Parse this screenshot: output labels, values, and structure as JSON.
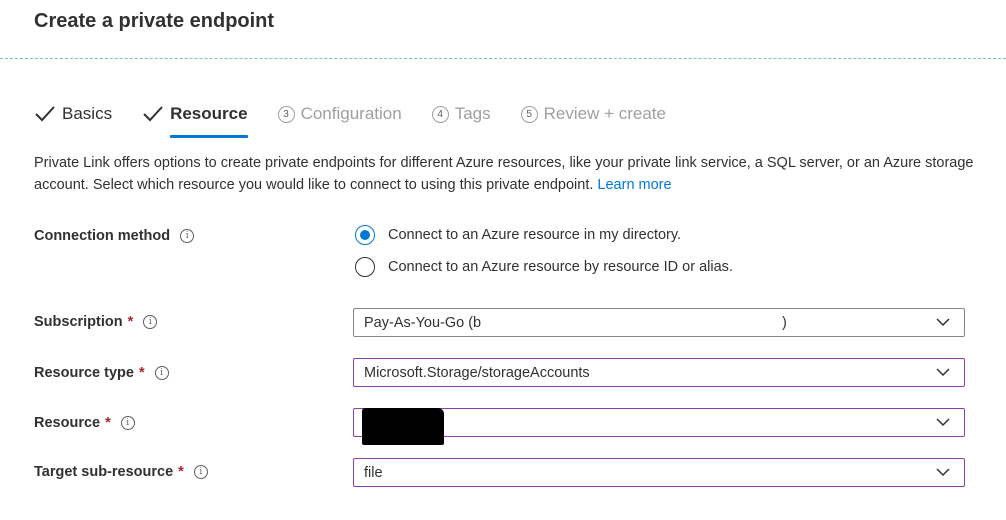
{
  "page": {
    "title": "Create a private endpoint"
  },
  "tabs": [
    {
      "label": "Basics",
      "state": "done"
    },
    {
      "label": "Resource",
      "state": "active"
    },
    {
      "label": "Configuration",
      "state": "pending",
      "step": "3"
    },
    {
      "label": "Tags",
      "state": "pending",
      "step": "4"
    },
    {
      "label": "Review + create",
      "state": "pending",
      "step": "5"
    }
  ],
  "description": {
    "text": "Private Link offers options to create private endpoints for different Azure resources, like your private link service, a SQL server, or an Azure storage account. Select which resource you would like to connect to using this private endpoint.",
    "link": "Learn more"
  },
  "connection_method": {
    "label": "Connection method",
    "options": [
      {
        "label": "Connect to an Azure resource in my directory.",
        "selected": true
      },
      {
        "label": "Connect to an Azure resource by resource ID or alias.",
        "selected": false
      }
    ]
  },
  "fields": {
    "subscription": {
      "label": "Subscription",
      "required_mark": "*",
      "value": "Pay-As-You-Go (b",
      "value_tail": ")"
    },
    "resource_type": {
      "label": "Resource type",
      "required_mark": "*",
      "value": "Microsoft.Storage/storageAccounts"
    },
    "resource": {
      "label": "Resource",
      "required_mark": "*",
      "value": ""
    },
    "target_sub_resource": {
      "label": "Target sub-resource",
      "required_mark": "*",
      "value": "file"
    }
  },
  "icons": {
    "info": "info-icon",
    "chevron": "chevron-down-icon",
    "check": "checkmark-icon"
  },
  "colors": {
    "accent": "#0078d4",
    "focus_border": "#8b3fa8",
    "required": "#a4262c",
    "pending_text": "#a19f9d"
  }
}
